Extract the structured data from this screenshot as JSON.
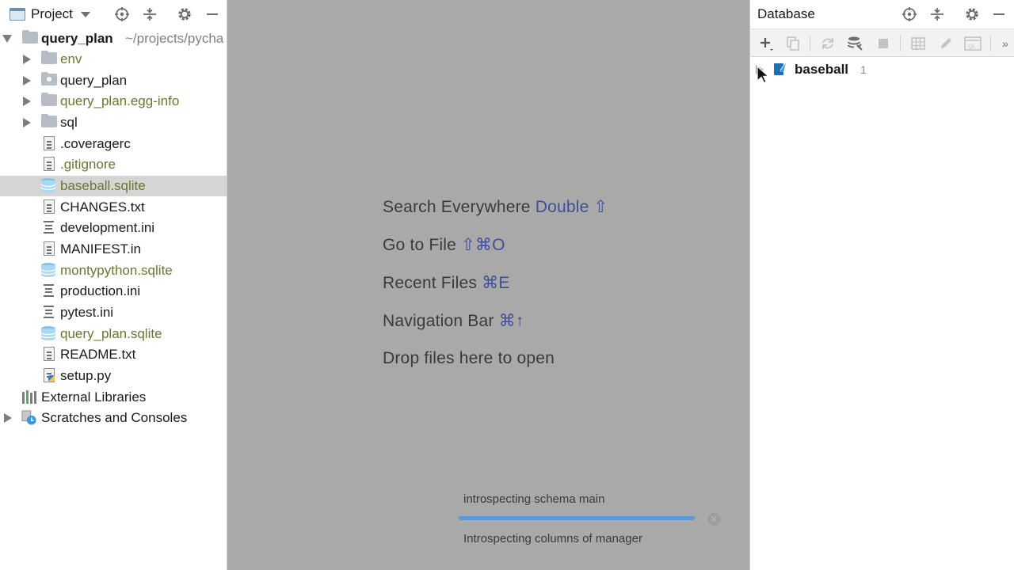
{
  "project_panel": {
    "title": "Project",
    "root": {
      "name": "query_plan",
      "path": "~/projects/pycha"
    },
    "items": [
      {
        "label": "env",
        "kind": "folder",
        "expander": true,
        "color": "olive"
      },
      {
        "label": "query_plan",
        "kind": "package",
        "expander": true,
        "color": "normal"
      },
      {
        "label": "query_plan.egg-info",
        "kind": "folder",
        "expander": true,
        "color": "olive"
      },
      {
        "label": "sql",
        "kind": "folder",
        "expander": true,
        "color": "normal"
      },
      {
        "label": ".coveragerc",
        "kind": "file",
        "color": "normal"
      },
      {
        "label": ".gitignore",
        "kind": "file",
        "color": "olive"
      },
      {
        "label": "baseball.sqlite",
        "kind": "db",
        "color": "olive",
        "selected": true
      },
      {
        "label": "CHANGES.txt",
        "kind": "file",
        "color": "normal"
      },
      {
        "label": "development.ini",
        "kind": "ini",
        "color": "normal"
      },
      {
        "label": "MANIFEST.in",
        "kind": "file",
        "color": "normal"
      },
      {
        "label": "montypython.sqlite",
        "kind": "db",
        "color": "olive"
      },
      {
        "label": "production.ini",
        "kind": "ini",
        "color": "normal"
      },
      {
        "label": "pytest.ini",
        "kind": "ini",
        "color": "normal"
      },
      {
        "label": "query_plan.sqlite",
        "kind": "db",
        "color": "olive"
      },
      {
        "label": "README.txt",
        "kind": "file",
        "color": "normal"
      },
      {
        "label": "setup.py",
        "kind": "python",
        "color": "normal"
      }
    ],
    "external_libraries": "External Libraries",
    "scratches": "Scratches and Consoles"
  },
  "editor": {
    "hints": [
      {
        "text": "Search Everywhere",
        "key": "Double ⇧"
      },
      {
        "text": "Go to File",
        "key": "⇧⌘O"
      },
      {
        "text": "Recent Files",
        "key": "⌘E"
      },
      {
        "text": "Navigation Bar",
        "key": "⌘↑"
      },
      {
        "text": "Drop files here to open",
        "key": ""
      }
    ],
    "progress": {
      "title": "introspecting schema main",
      "status": "Introspecting columns of manager",
      "fraction": 1.0
    }
  },
  "database_panel": {
    "title": "Database",
    "datasource": {
      "name": "baseball",
      "count": "1"
    }
  },
  "colors": {
    "olive_text": "#6e7431",
    "shortcut_key": "#3f4f9a",
    "editor_bg": "#a9a9a9",
    "selection": "#d5d5d5",
    "progress": "#5d97d8"
  }
}
